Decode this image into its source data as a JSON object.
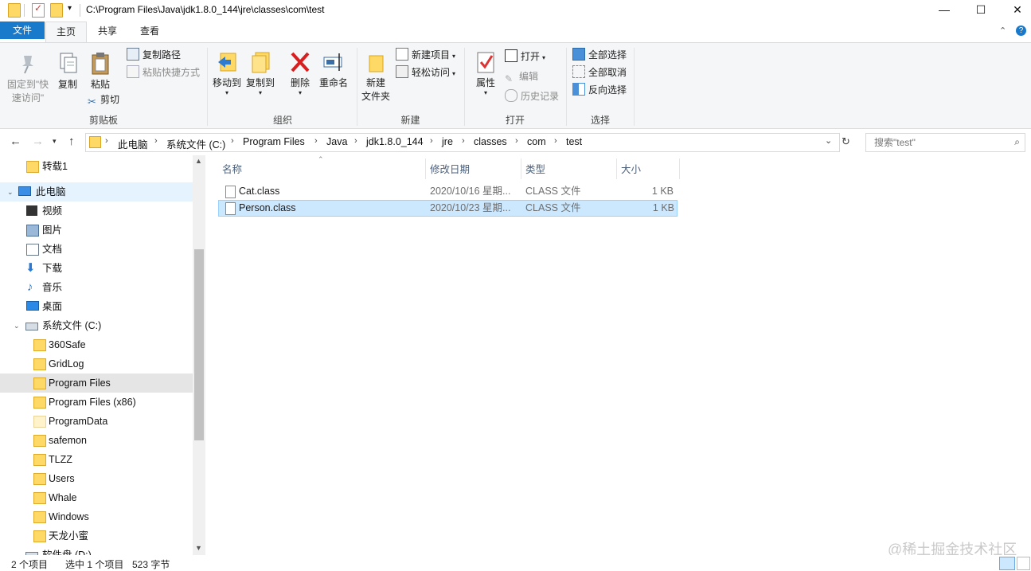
{
  "window": {
    "path": "C:\\Program Files\\Java\\jdk1.8.0_144\\jre\\classes\\com\\test",
    "minimize": "—",
    "maximize": "☐",
    "close": "✕"
  },
  "tabs": {
    "file": "文件",
    "home": "主页",
    "share": "共享",
    "view": "查看"
  },
  "ribbon": {
    "clipboard": {
      "label": "剪贴板",
      "pin_line1": "固定到\"快",
      "pin_line2": "速访问\"",
      "copy": "复制",
      "paste": "粘贴",
      "copy_path": "复制路径",
      "paste_shortcut": "粘贴快捷方式",
      "cut": "剪切"
    },
    "organize": {
      "label": "组织",
      "move_to": "移动到",
      "copy_to": "复制到",
      "delete": "删除",
      "rename": "重命名"
    },
    "new": {
      "label": "新建",
      "new_folder_line1": "新建",
      "new_folder_line2": "文件夹",
      "new_item": "新建项目",
      "easy_access": "轻松访问"
    },
    "open": {
      "label": "打开",
      "properties": "属性",
      "open": "打开",
      "edit": "编辑",
      "history": "历史记录"
    },
    "select": {
      "label": "选择",
      "select_all": "全部选择",
      "select_none": "全部取消",
      "invert": "反向选择"
    }
  },
  "breadcrumbs": [
    "此电脑",
    "系统文件 (C:)",
    "Program Files",
    "Java",
    "jdk1.8.0_144",
    "jre",
    "classes",
    "com",
    "test"
  ],
  "search": {
    "placeholder": "搜索\"test\""
  },
  "sidebar": {
    "items": [
      {
        "label": "转载1"
      },
      {
        "label": "此电脑"
      },
      {
        "label": "视频"
      },
      {
        "label": "图片"
      },
      {
        "label": "文档"
      },
      {
        "label": "下载"
      },
      {
        "label": "音乐"
      },
      {
        "label": "桌面"
      },
      {
        "label": "系统文件 (C:)"
      },
      {
        "label": "360Safe"
      },
      {
        "label": "GridLog"
      },
      {
        "label": "Program Files"
      },
      {
        "label": "Program Files (x86)"
      },
      {
        "label": "ProgramData"
      },
      {
        "label": "safemon"
      },
      {
        "label": "TLZZ"
      },
      {
        "label": "Users"
      },
      {
        "label": "Whale"
      },
      {
        "label": "Windows"
      },
      {
        "label": "天龙小蜜"
      },
      {
        "label": "软件盘 (D:)"
      }
    ]
  },
  "columns": {
    "name": "名称",
    "date": "修改日期",
    "type": "类型",
    "size": "大小"
  },
  "files": [
    {
      "name": "Cat.class",
      "date": "2020/10/16 星期...",
      "type": "CLASS 文件",
      "size": "1 KB"
    },
    {
      "name": "Person.class",
      "date": "2020/10/23 星期...",
      "type": "CLASS 文件",
      "size": "1 KB"
    }
  ],
  "status": {
    "count": "2 个项目",
    "selected": "选中 1 个项目",
    "bytes": "523 字节"
  },
  "watermark": "@稀土掘金技术社区",
  "colors": {
    "accent": "#1979ca",
    "selection": "#cce8ff",
    "folder": "#ffd966"
  }
}
